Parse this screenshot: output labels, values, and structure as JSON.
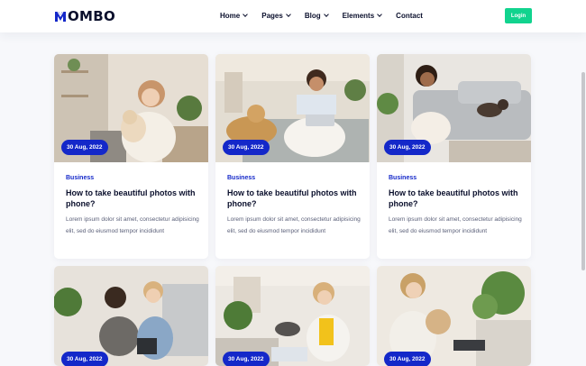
{
  "header": {
    "logo_text": "OMBO",
    "nav": [
      {
        "label": "Home",
        "dropdown": true
      },
      {
        "label": "Pages",
        "dropdown": true
      },
      {
        "label": "Blog",
        "dropdown": true
      },
      {
        "label": "Elements",
        "dropdown": true
      },
      {
        "label": "Contact",
        "dropdown": false
      }
    ],
    "login_label": "Login"
  },
  "colors": {
    "accent": "#1428c9",
    "login": "#11d38e",
    "heading": "#0a0f2c",
    "body_text": "#5b6079"
  },
  "posts": [
    {
      "date": "30 Aug, 2022",
      "category": "Business",
      "title": "How to take beautiful photos with phone?",
      "excerpt": "Lorem ipsum dolor sit amet, consectetur adipisicing elit, sed do eiusmod tempor incididunt",
      "image": "woman-with-dog-photo"
    },
    {
      "date": "30 Aug, 2022",
      "category": "Business",
      "title": "How to take beautiful photos with phone?",
      "excerpt": "Lorem ipsum dolor sit amet, consectetur adipisicing elit, sed do eiusmod tempor incididunt",
      "image": "woman-laptop-dog-photo"
    },
    {
      "date": "30 Aug, 2022",
      "category": "Business",
      "title": "How to take beautiful photos with phone?",
      "excerpt": "Lorem ipsum dolor sit amet, consectetur adipisicing elit, sed do eiusmod tempor incididunt",
      "image": "woman-sofa-dog-photo"
    },
    {
      "date": "30 Aug, 2022",
      "image": "couple-headphones-photo"
    },
    {
      "date": "30 Aug, 2022",
      "image": "woman-phone-laptop-photo"
    },
    {
      "date": "30 Aug, 2022",
      "image": "woman-glasses-dog-photo"
    }
  ]
}
